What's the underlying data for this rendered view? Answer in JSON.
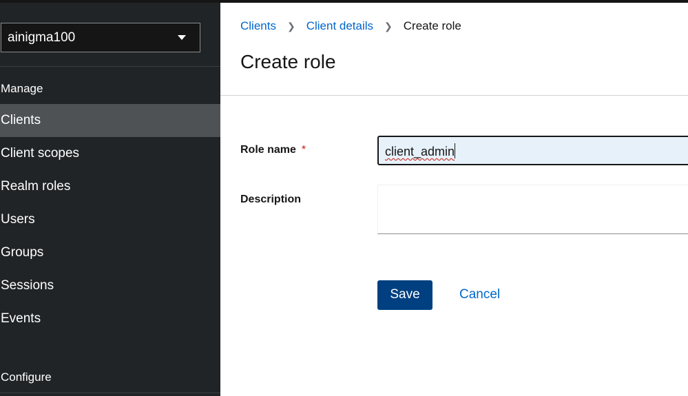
{
  "sidebar": {
    "realm_selector": {
      "value": "ainigma100"
    },
    "manage_heading": "Manage",
    "manage_items": [
      {
        "label": "Clients",
        "active": true
      },
      {
        "label": "Client scopes"
      },
      {
        "label": "Realm roles"
      },
      {
        "label": "Users"
      },
      {
        "label": "Groups"
      },
      {
        "label": "Sessions"
      },
      {
        "label": "Events"
      }
    ],
    "configure_heading": "Configure"
  },
  "breadcrumb": [
    {
      "label": "Clients"
    },
    {
      "label": "Client details"
    },
    {
      "label": "Create role"
    }
  ],
  "page_title": "Create role",
  "form": {
    "role_name": {
      "label": "Role name",
      "required_marker": "*",
      "value": "client_admin"
    },
    "description": {
      "label": "Description",
      "value": ""
    }
  },
  "actions": {
    "save_label": "Save",
    "cancel_label": "Cancel"
  },
  "colors": {
    "accent": "#0066cc",
    "primary_button": "#004080",
    "sidebar_bg": "#212427",
    "active_item_bg": "#4f5255",
    "required": "#c9190b"
  }
}
